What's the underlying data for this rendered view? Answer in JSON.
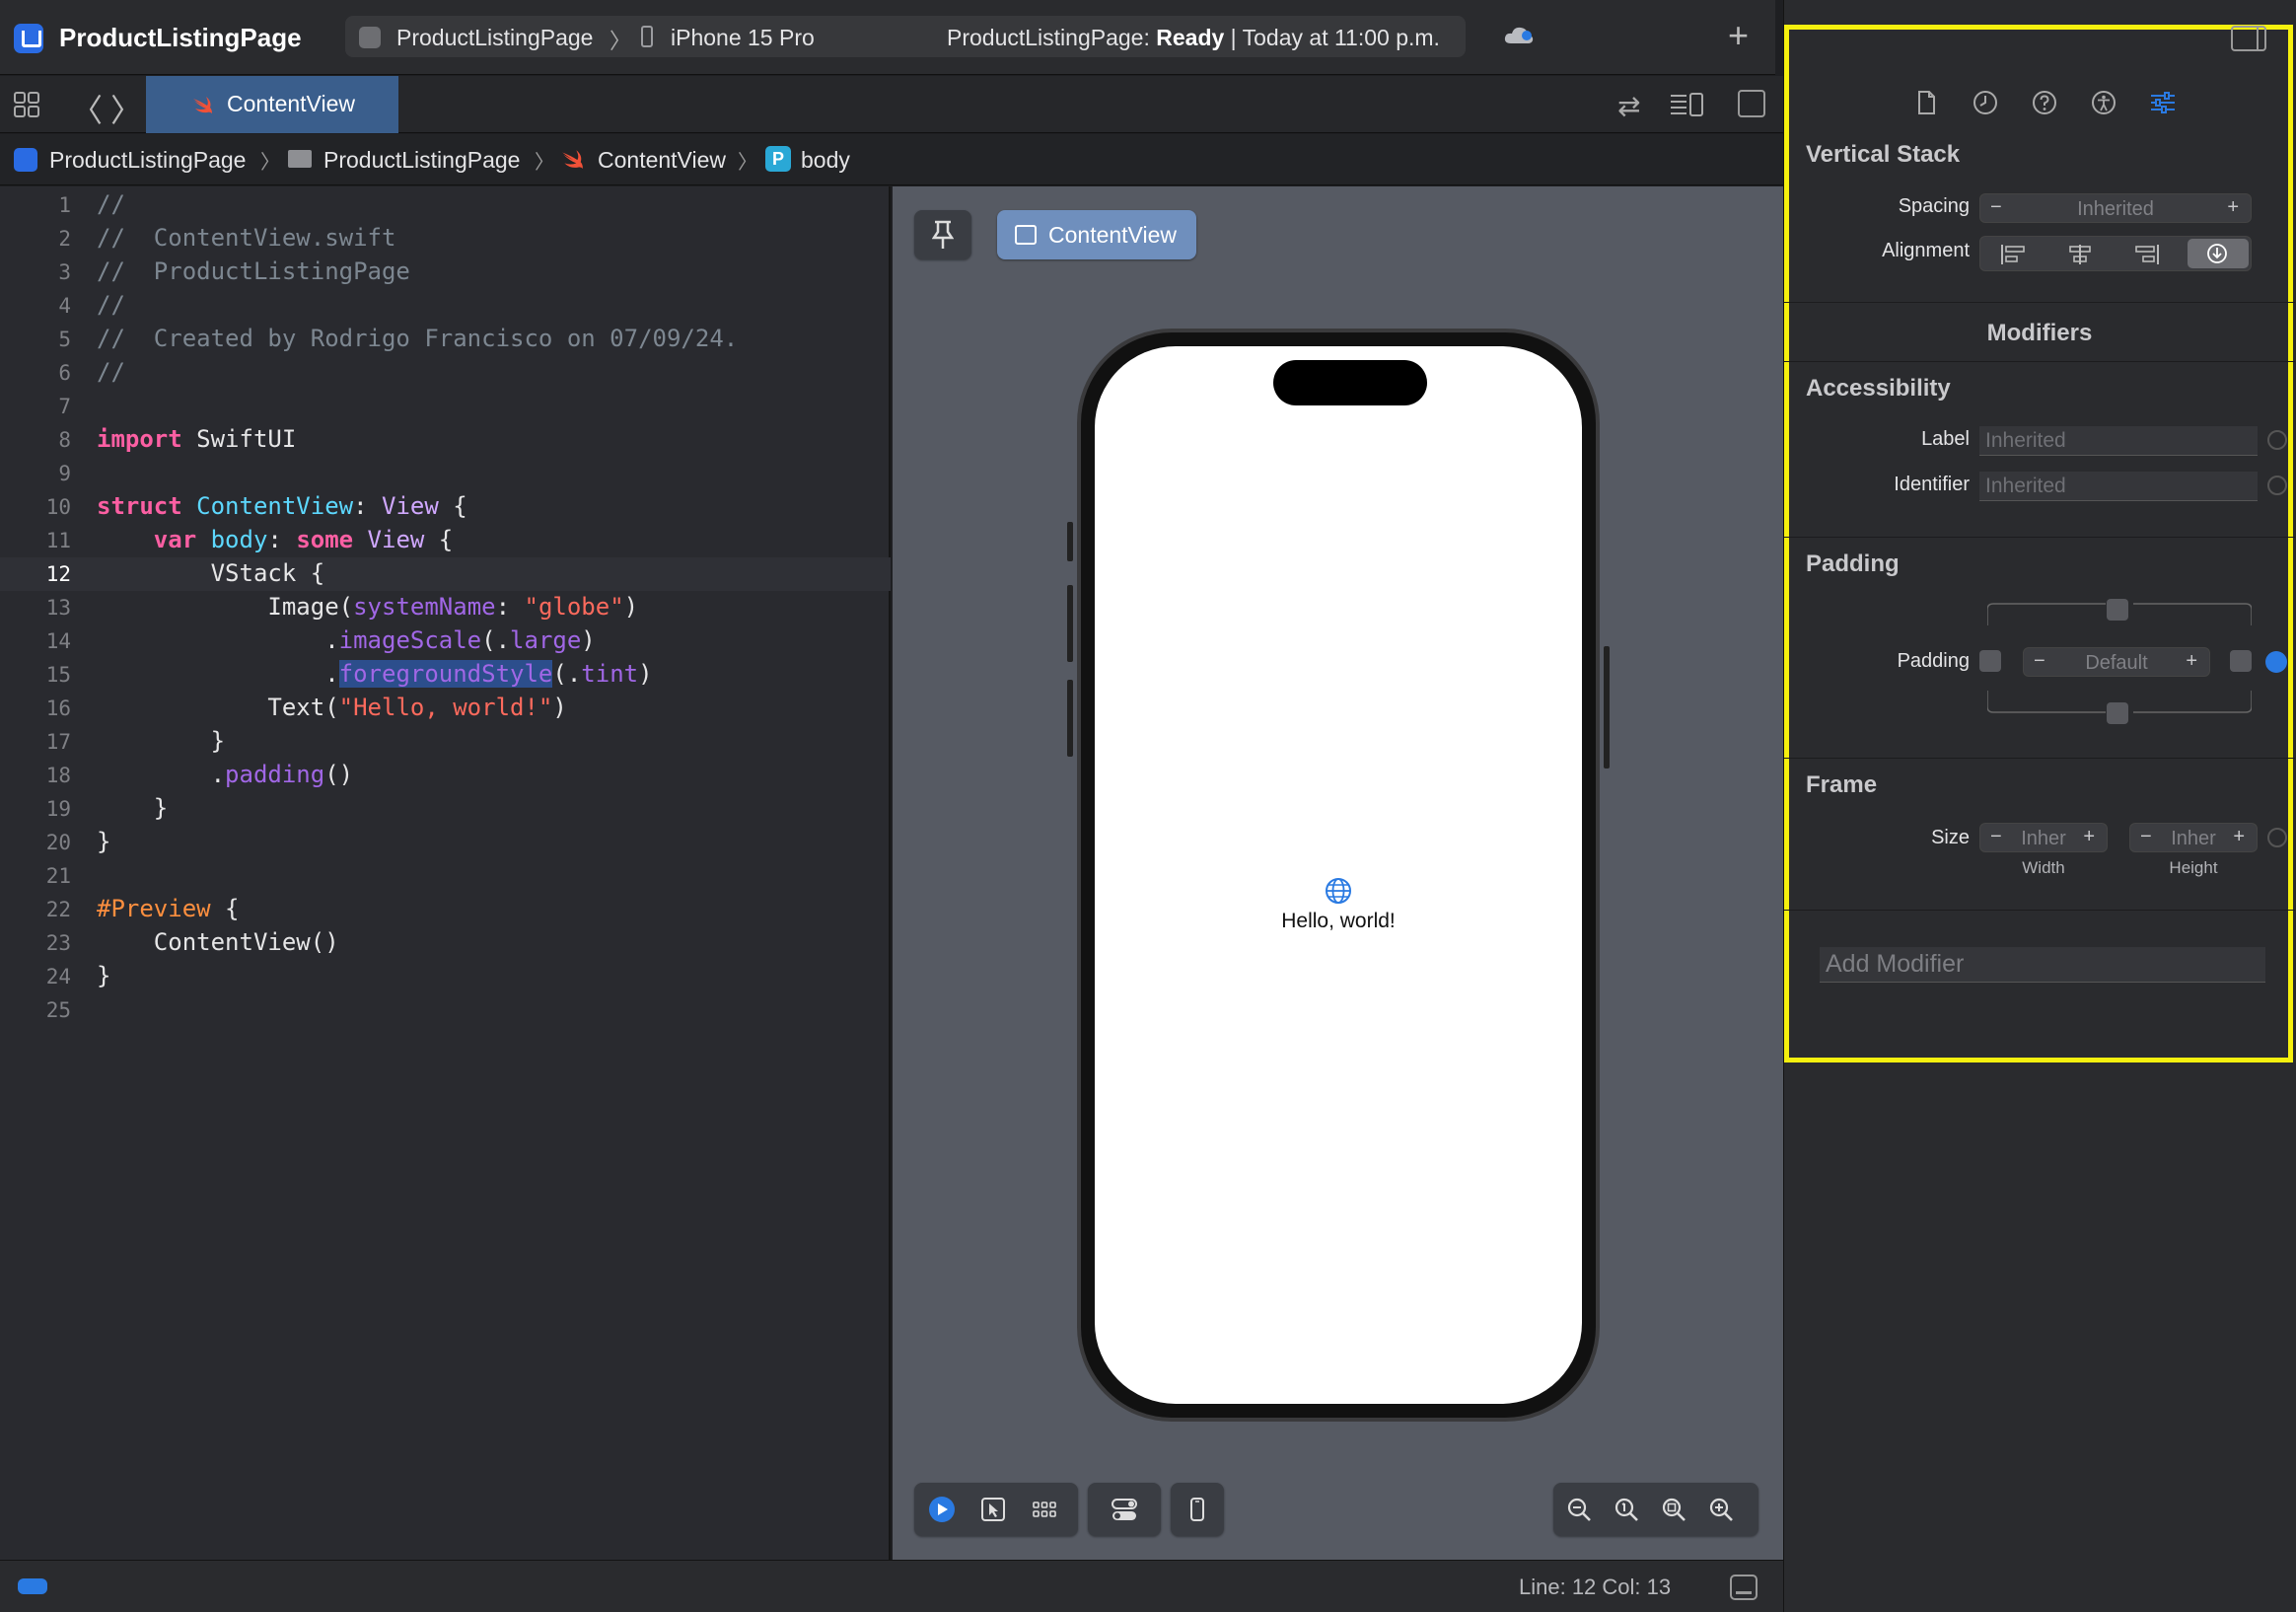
{
  "titlebar": {
    "project_name": "ProductListingPage",
    "scheme_name": "ProductListingPage",
    "scheme_separator": "〉",
    "device": "iPhone 15 Pro",
    "status_prefix": "ProductListingPage: ",
    "status_state": "Ready",
    "status_suffix": " | Today at 11:00 p.m.",
    "add_label": "+"
  },
  "tabbar": {
    "back_label": "〈",
    "forward_label": "〉",
    "active_tab": "ContentView",
    "swap_icon_glyph": "⇄"
  },
  "breadcrumb": {
    "items": [
      "ProductListingPage",
      "ProductListingPage",
      "ContentView",
      "body"
    ],
    "separator": "〉",
    "symbol_badge": "P"
  },
  "editor": {
    "current_line": 12,
    "line_numbers": [
      "1",
      "2",
      "3",
      "4",
      "5",
      "6",
      "7",
      "8",
      "9",
      "10",
      "11",
      "12",
      "13",
      "14",
      "15",
      "16",
      "17",
      "18",
      "19",
      "20",
      "21",
      "22",
      "23",
      "24",
      "25"
    ],
    "lines": {
      "l1": "//",
      "l2": "//  ContentView.swift",
      "l3": "//  ProductListingPage",
      "l4": "//",
      "l5": "//  Created by Rodrigo Francisco on 07/09/24.",
      "l6": "//",
      "l8_kw": "import",
      "l8_rest": " SwiftUI",
      "l10_kw": "struct",
      "l10_name": " ContentView",
      "l10_colon": ": ",
      "l10_type": "View",
      "l10_brace": " {",
      "l11_indent": "    ",
      "l11_kw": "var",
      "l11_name": " body",
      "l11_colon": ": ",
      "l11_kw2": "some",
      "l11_type": " View",
      "l11_brace": " {",
      "l12": "        VStack {",
      "l13_a": "            Image(",
      "l13_param": "systemName",
      "l13_colon": ": ",
      "l13_str": "\"globe\"",
      "l13_close": ")",
      "l14_a": "                .",
      "l14_fn": "imageScale",
      "l14_open": "(.",
      "l14_arg": "large",
      "l14_close": ")",
      "l15_a": "                .",
      "l15_fn": "foregroundStyle",
      "l15_open": "(.",
      "l15_arg": "tint",
      "l15_close": ")",
      "l16_a": "            Text(",
      "l16_str": "\"Hello, world!\"",
      "l16_close": ")",
      "l17": "        }",
      "l18_a": "        .",
      "l18_fn": "padding",
      "l18_close": "()",
      "l19": "    }",
      "l20": "}",
      "l22_attr": "#Preview",
      "l22_brace": " {",
      "l23": "    ContentView()",
      "l24": "}"
    }
  },
  "canvas": {
    "preview_chip_label": "ContentView",
    "phone_text": "Hello, world!",
    "accent": "#2a7ae2"
  },
  "inspector": {
    "vertical_stack": {
      "title": "Vertical Stack",
      "spacing_label": "Spacing",
      "spacing_value": "Inherited",
      "alignment_label": "Alignment"
    },
    "modifiers_title": "Modifiers",
    "accessibility": {
      "title": "Accessibility",
      "label_label": "Label",
      "label_placeholder": "Inherited",
      "identifier_label": "Identifier",
      "identifier_placeholder": "Inherited"
    },
    "padding": {
      "title": "Padding",
      "padding_label": "Padding",
      "padding_value": "Default"
    },
    "frame": {
      "title": "Frame",
      "size_label": "Size",
      "width_value": "Inher",
      "height_value": "Inher",
      "width_caption": "Width",
      "height_caption": "Height"
    },
    "add_modifier_placeholder": "Add Modifier",
    "stepper_minus": "−",
    "stepper_plus": "+",
    "highlight_color": "#f5f00e"
  },
  "statusbar": {
    "line_col": "Line: 12  Col: 13"
  }
}
